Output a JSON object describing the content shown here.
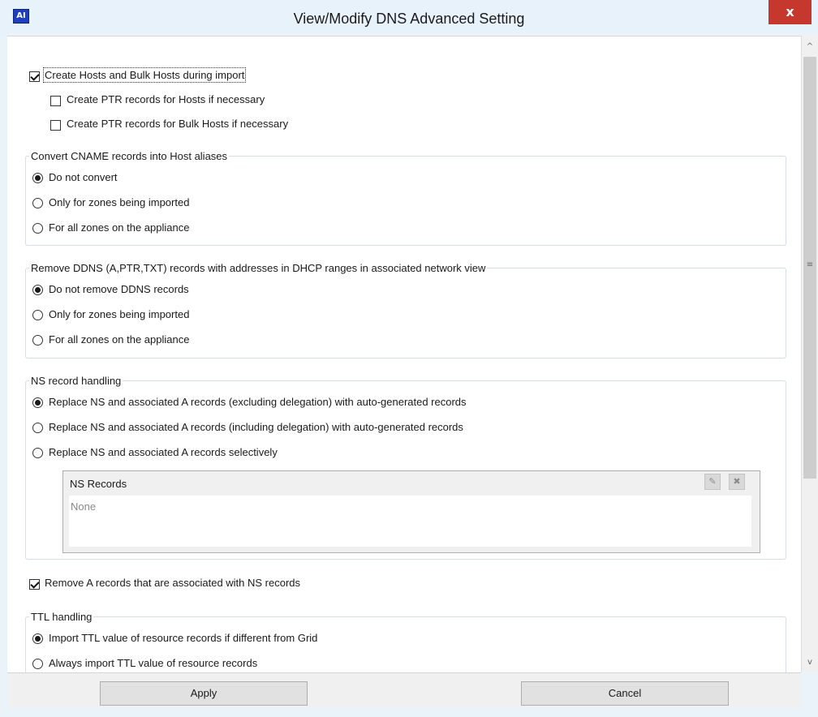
{
  "window": {
    "title": "View/Modify DNS Advanced Setting",
    "app_icon_text": "AI",
    "close_label": "x"
  },
  "import_section": {
    "create_hosts": {
      "label": "Create Hosts and Bulk Hosts during import",
      "checked": true
    },
    "ptr_hosts": {
      "label": "Create PTR records for Hosts if necessary",
      "checked": false
    },
    "ptr_bulk_hosts": {
      "label": "Create PTR records for Bulk Hosts if necessary",
      "checked": false
    }
  },
  "cname_group": {
    "legend": "Convert CNAME records into Host aliases",
    "options": [
      {
        "label": "Do not convert",
        "selected": true
      },
      {
        "label": "Only for zones being imported",
        "selected": false
      },
      {
        "label": "For all zones on the appliance",
        "selected": false
      }
    ]
  },
  "ddns_group": {
    "legend": "Remove DDNS (A,PTR,TXT) records with addresses in DHCP ranges in associated network view",
    "options": [
      {
        "label": "Do not remove DDNS records",
        "selected": true
      },
      {
        "label": "Only for zones being imported",
        "selected": false
      },
      {
        "label": "For all zones on the appliance",
        "selected": false
      }
    ]
  },
  "ns_group": {
    "legend": "NS record handling",
    "options": [
      {
        "label": "Replace NS and associated A records (excluding delegation) with auto-generated records",
        "selected": true
      },
      {
        "label": "Replace NS and associated A records (including delegation) with auto-generated records",
        "selected": false
      },
      {
        "label": "Replace NS and associated A records selectively",
        "selected": false
      }
    ],
    "ns_records": {
      "title": "NS Records",
      "empty_text": "None",
      "tools": [
        "edit-icon",
        "delete-icon"
      ]
    }
  },
  "remove_a_records": {
    "label": "Remove A records that are associated with NS records",
    "checked": true
  },
  "ttl_group": {
    "legend": "TTL handling",
    "options": [
      {
        "label": "Import TTL value of resource records if different from Grid",
        "selected": true
      },
      {
        "label": "Always import TTL value of resource records",
        "selected": false
      }
    ]
  },
  "footer": {
    "apply_label": "Apply",
    "cancel_label": "Cancel"
  },
  "scrollbar": {
    "up_arrow": "^",
    "down_arrow": "v",
    "grip": "≡"
  }
}
